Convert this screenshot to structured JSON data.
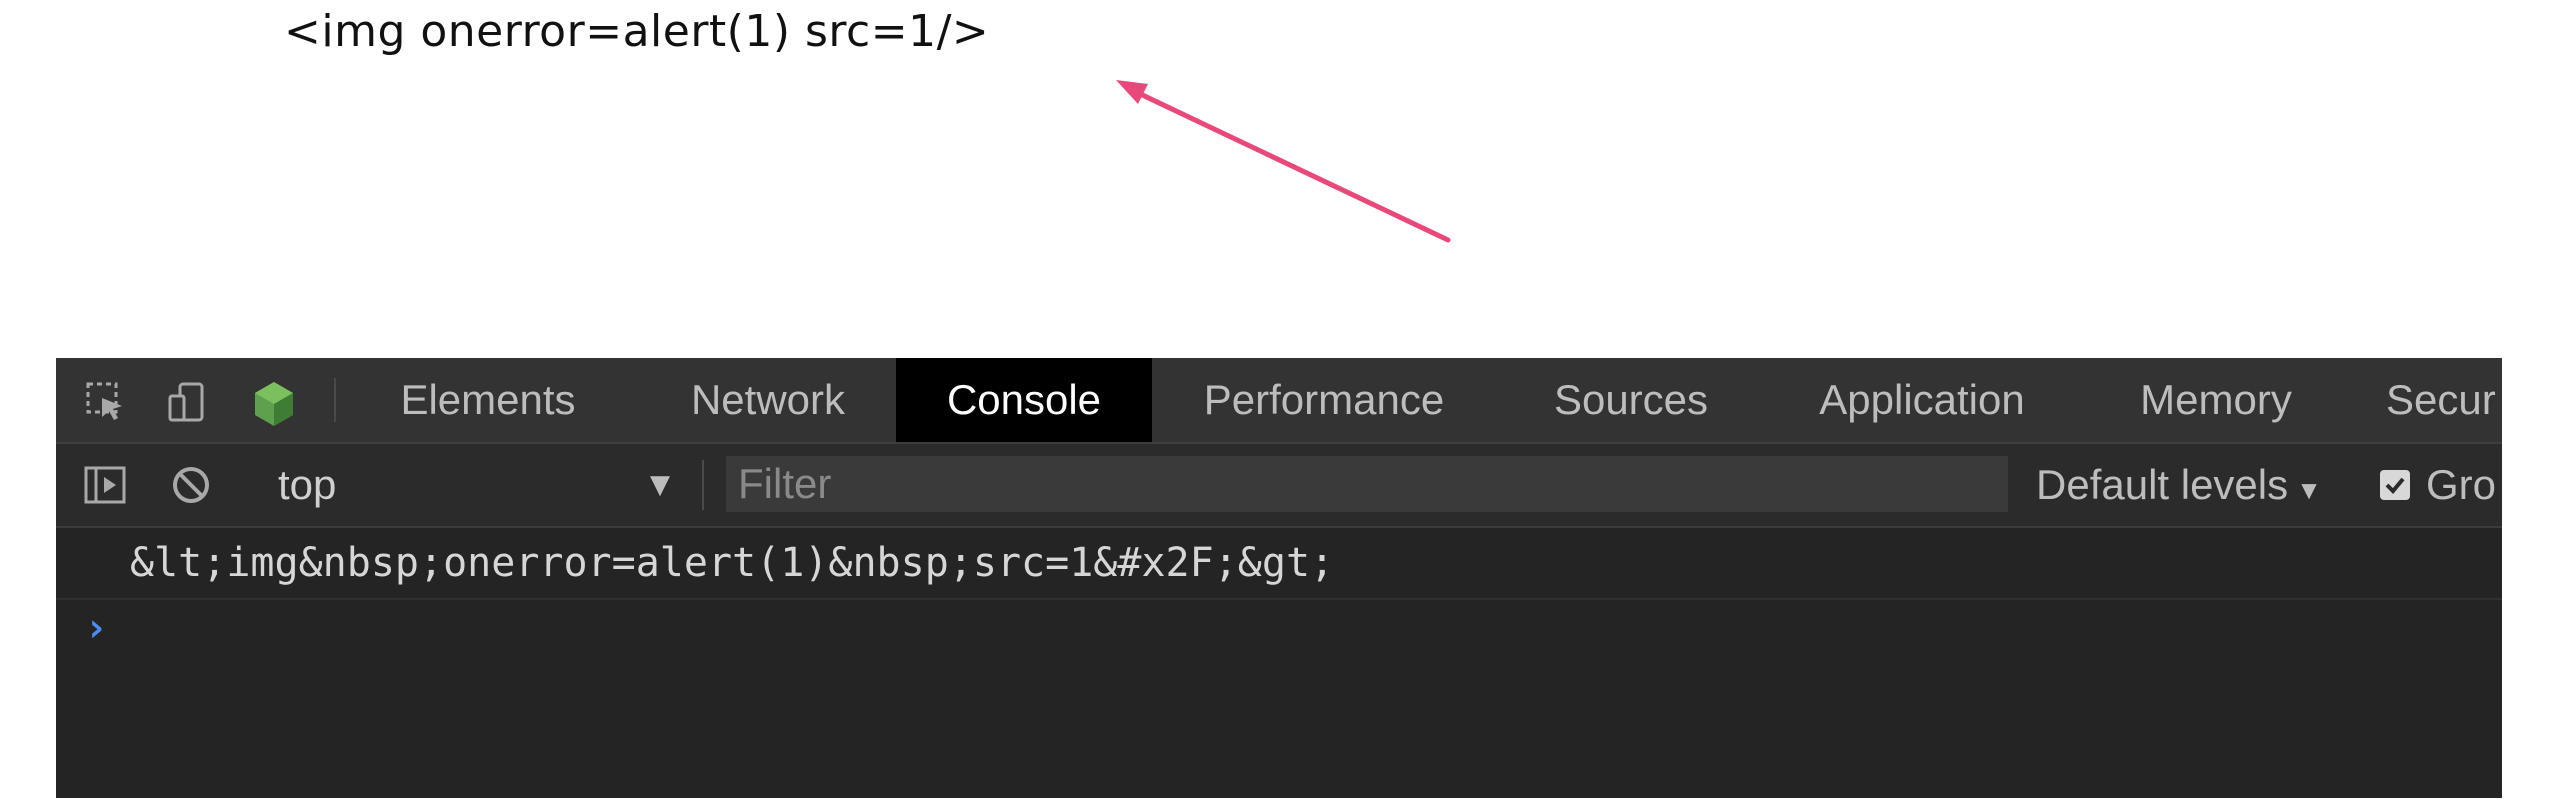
{
  "page": {
    "rendered_text": "<img onerror=alert(1) src=1/>"
  },
  "colors": {
    "annotation_arrow": "#e8487a",
    "devtools_bg": "#242424",
    "tabbar_bg": "#333333",
    "active_tab_bg": "#000000",
    "prompt_caret": "#4d8cf5"
  },
  "devtools": {
    "tabs": [
      {
        "label": "Elements",
        "active": false
      },
      {
        "label": "Network",
        "active": false
      },
      {
        "label": "Console",
        "active": true
      },
      {
        "label": "Performance",
        "active": false
      },
      {
        "label": "Sources",
        "active": false
      },
      {
        "label": "Application",
        "active": false
      },
      {
        "label": "Memory",
        "active": false
      },
      {
        "label": "Secur",
        "active": false
      }
    ],
    "icons": {
      "inspect": "inspect-element-icon",
      "device": "device-toolbar-icon",
      "node": "node-hexagon-icon"
    },
    "toolbar": {
      "sidebar_icon": "sidebar-toggle-icon",
      "clear_icon": "clear-console-icon",
      "context": "top",
      "context_caret": "▼",
      "filter_placeholder": "Filter",
      "filter_value": "",
      "levels_label": "Default levels",
      "levels_caret": "▼",
      "group_checked": true,
      "group_label": "Gro"
    },
    "console": {
      "log_line": "&lt;img&nbsp;onerror=alert(1)&nbsp;src=1&#x2F;&gt;",
      "prompt": "›"
    }
  }
}
